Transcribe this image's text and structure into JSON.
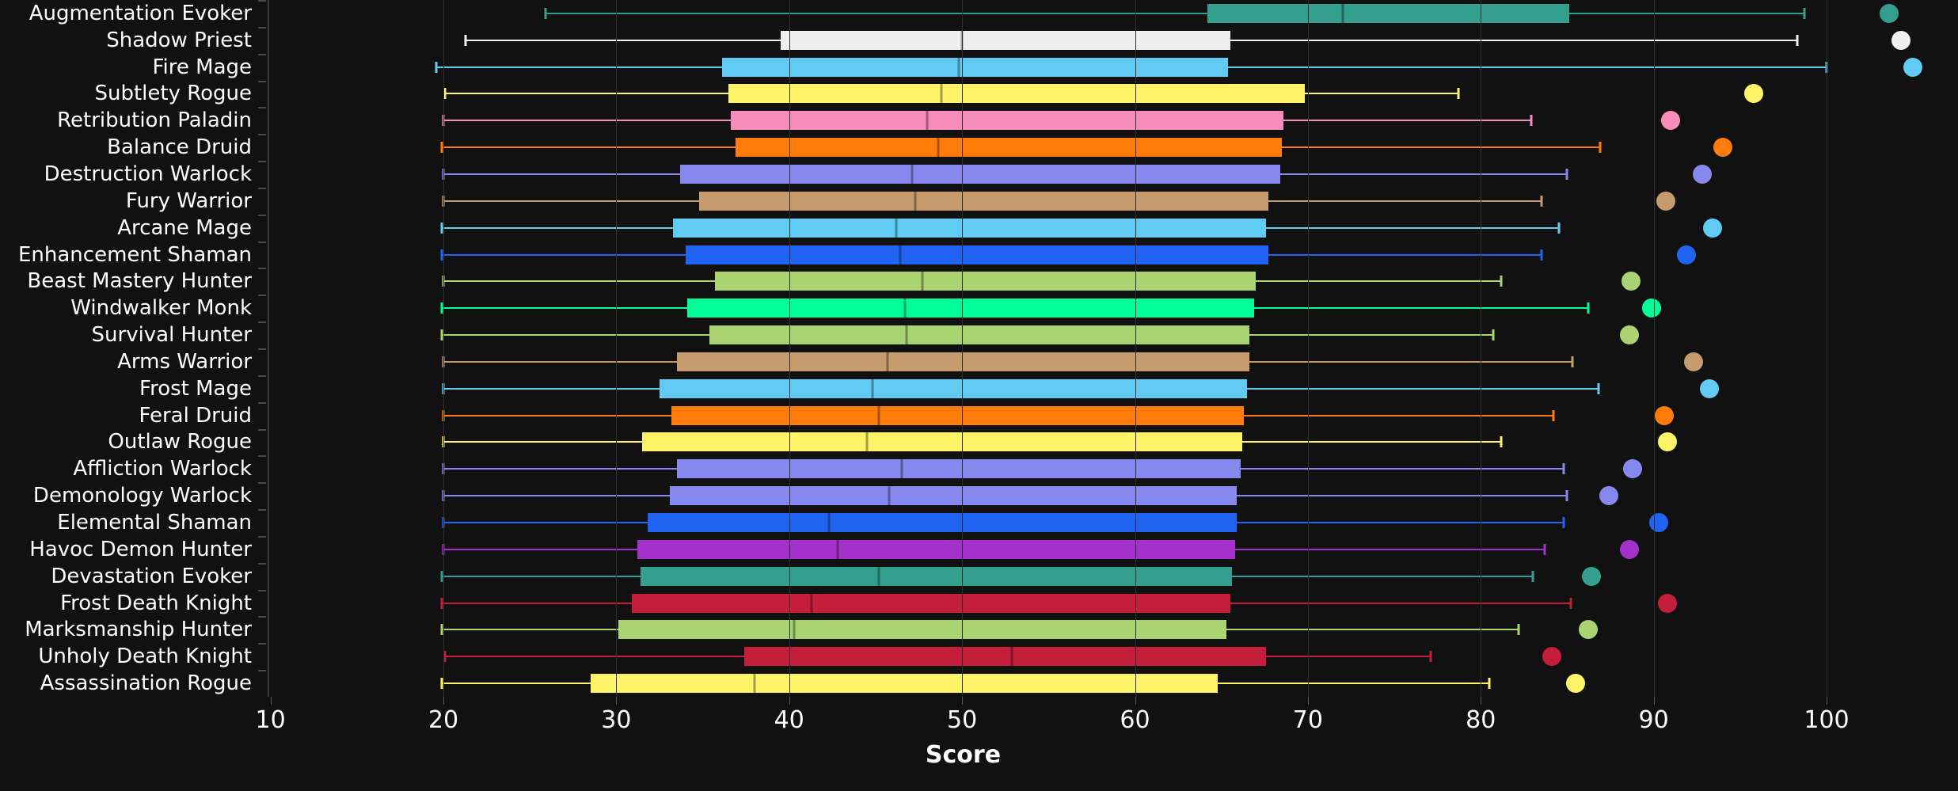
{
  "chart_data": {
    "type": "box",
    "title": "",
    "xlabel": "Score",
    "ylabel": "",
    "xlim": [
      10,
      103
    ],
    "xticks": [
      10,
      20,
      30,
      40,
      50,
      60,
      70,
      80,
      90,
      100
    ],
    "grid": true,
    "orientation": "horizontal",
    "categories": [
      "Augmentation Evoker",
      "Shadow Priest",
      "Fire Mage",
      "Subtlety Rogue",
      "Retribution Paladin",
      "Balance Druid",
      "Destruction Warlock",
      "Fury Warrior",
      "Arcane Mage",
      "Enhancement Shaman",
      "Beast Mastery Hunter",
      "Windwalker Monk",
      "Survival Hunter",
      "Arms Warrior",
      "Frost Mage",
      "Feral Druid",
      "Outlaw Rogue",
      "Affliction Warlock",
      "Demonology Warlock",
      "Elemental Shaman",
      "Havoc Demon Hunter",
      "Devastation Evoker",
      "Frost Death Knight",
      "Marksmanship Hunter",
      "Unholy Death Knight",
      "Assassination Rogue"
    ],
    "boxes": [
      {
        "label": "Augmentation Evoker",
        "color": "#339E8E",
        "min": 25.9,
        "q1": 64.2,
        "median": 72.0,
        "q3": 85.1,
        "max": 98.7,
        "outlier": 103.6
      },
      {
        "label": "Shadow Priest",
        "color": "#EFEFEF",
        "min": 21.3,
        "q1": 39.5,
        "median": 50.0,
        "q3": 65.5,
        "max": 98.3,
        "outlier": 104.3
      },
      {
        "label": "Fire Mage",
        "color": "#61CBF4",
        "min": 19.6,
        "q1": 36.1,
        "median": 49.8,
        "q3": 65.4,
        "max": 100.0,
        "outlier": 105.0
      },
      {
        "label": "Subtlety Rogue",
        "color": "#FFF468",
        "min": 20.1,
        "q1": 36.5,
        "median": 48.8,
        "q3": 69.8,
        "max": 78.7,
        "outlier": 95.8
      },
      {
        "label": "Retribution Paladin",
        "color": "#F58CBA",
        "min": 20.0,
        "q1": 36.6,
        "median": 48.0,
        "q3": 68.6,
        "max": 82.9,
        "outlier": 91.0
      },
      {
        "label": "Balance Druid",
        "color": "#FF7C0A",
        "min": 19.9,
        "q1": 36.9,
        "median": 48.6,
        "q3": 68.5,
        "max": 86.9,
        "outlier": 94.0
      },
      {
        "label": "Destruction Warlock",
        "color": "#8788EE",
        "min": 20.0,
        "q1": 33.7,
        "median": 47.1,
        "q3": 68.4,
        "max": 85.0,
        "outlier": 92.8
      },
      {
        "label": "Fury Warrior",
        "color": "#C69B6D",
        "min": 20.0,
        "q1": 34.8,
        "median": 47.3,
        "q3": 67.7,
        "max": 83.5,
        "outlier": 90.7
      },
      {
        "label": "Arcane Mage",
        "color": "#61CBF4",
        "min": 19.9,
        "q1": 33.3,
        "median": 46.2,
        "q3": 67.6,
        "max": 84.5,
        "outlier": 93.4
      },
      {
        "label": "Enhancement Shaman",
        "color": "#2164F3",
        "min": 19.9,
        "q1": 34.0,
        "median": 46.4,
        "q3": 67.7,
        "max": 83.5,
        "outlier": 91.9
      },
      {
        "label": "Beast Mastery Hunter",
        "color": "#AAD372",
        "min": 20.0,
        "q1": 35.7,
        "median": 47.7,
        "q3": 67.0,
        "max": 81.2,
        "outlier": 88.7
      },
      {
        "label": "Windwalker Monk",
        "color": "#00FF98",
        "min": 19.9,
        "q1": 34.1,
        "median": 46.7,
        "q3": 66.9,
        "max": 86.2,
        "outlier": 89.9
      },
      {
        "label": "Survival Hunter",
        "color": "#AAD372",
        "min": 19.9,
        "q1": 35.4,
        "median": 46.8,
        "q3": 66.6,
        "max": 80.7,
        "outlier": 88.6
      },
      {
        "label": "Arms Warrior",
        "color": "#C69B6D",
        "min": 20.0,
        "q1": 33.5,
        "median": 45.7,
        "q3": 66.6,
        "max": 85.3,
        "outlier": 92.3
      },
      {
        "label": "Frost Mage",
        "color": "#61CBF4",
        "min": 20.0,
        "q1": 32.5,
        "median": 44.8,
        "q3": 66.5,
        "max": 86.8,
        "outlier": 93.2
      },
      {
        "label": "Feral Druid",
        "color": "#FF7C0A",
        "min": 20.0,
        "q1": 33.2,
        "median": 45.2,
        "q3": 66.3,
        "max": 84.2,
        "outlier": 90.6
      },
      {
        "label": "Outlaw Rogue",
        "color": "#FFF468",
        "min": 20.0,
        "q1": 31.5,
        "median": 44.5,
        "q3": 66.2,
        "max": 81.2,
        "outlier": 90.8
      },
      {
        "label": "Affliction Warlock",
        "color": "#8788EE",
        "min": 20.0,
        "q1": 33.5,
        "median": 46.5,
        "q3": 66.1,
        "max": 84.8,
        "outlier": 88.8
      },
      {
        "label": "Demonology Warlock",
        "color": "#8788EE",
        "min": 20.0,
        "q1": 33.1,
        "median": 45.8,
        "q3": 65.9,
        "max": 85.0,
        "outlier": 87.4
      },
      {
        "label": "Elemental Shaman",
        "color": "#2164F3",
        "min": 20.0,
        "q1": 31.8,
        "median": 42.3,
        "q3": 65.9,
        "max": 84.8,
        "outlier": 90.3
      },
      {
        "label": "Havoc Demon Hunter",
        "color": "#A330C9",
        "min": 20.0,
        "q1": 31.2,
        "median": 42.8,
        "q3": 65.8,
        "max": 83.7,
        "outlier": 88.6
      },
      {
        "label": "Devastation Evoker",
        "color": "#339E8E",
        "min": 19.9,
        "q1": 31.4,
        "median": 45.2,
        "q3": 65.6,
        "max": 83.0,
        "outlier": 86.4
      },
      {
        "label": "Frost Death Knight",
        "color": "#C41E3A",
        "min": 19.9,
        "q1": 30.9,
        "median": 41.3,
        "q3": 65.5,
        "max": 85.2,
        "outlier": 90.8
      },
      {
        "label": "Marksmanship Hunter",
        "color": "#AAD372",
        "min": 19.9,
        "q1": 30.1,
        "median": 40.3,
        "q3": 65.3,
        "max": 82.2,
        "outlier": 86.2
      },
      {
        "label": "Unholy Death Knight",
        "color": "#C41E3A",
        "min": 20.1,
        "q1": 37.4,
        "median": 52.9,
        "q3": 67.6,
        "max": 77.1,
        "outlier": 84.1
      },
      {
        "label": "Assassination Rogue",
        "color": "#FFF468",
        "min": 19.9,
        "q1": 28.5,
        "median": 38.0,
        "q3": 64.8,
        "max": 80.5,
        "outlier": 85.5
      }
    ]
  },
  "axis": {
    "x_title": "Score",
    "x_tick_labels": [
      "10",
      "20",
      "30",
      "40",
      "50",
      "60",
      "70",
      "80",
      "90",
      "100"
    ]
  },
  "colors": {
    "background": "#111111",
    "gridline": "#2e2e2e",
    "axis": "#3a3a3a",
    "text": "#ffffff"
  }
}
